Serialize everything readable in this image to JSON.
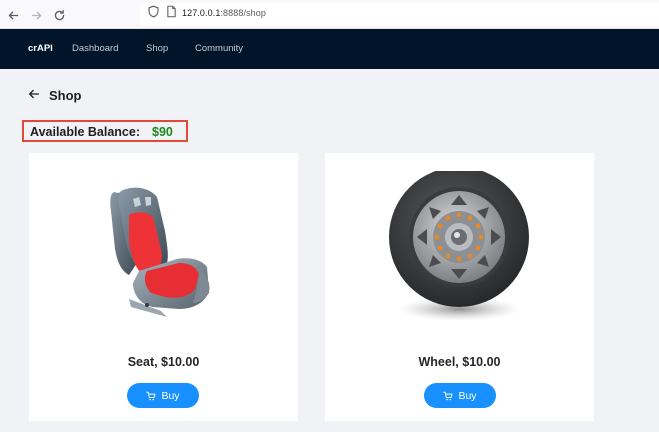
{
  "browser": {
    "url_host": "127.0.0.1",
    "url_path": ":8888/shop",
    "icons": [
      "back-arrow-icon",
      "forward-arrow-icon",
      "reload-icon",
      "shield-icon",
      "page-icon"
    ]
  },
  "navbar": {
    "brand": "crAPI",
    "links": [
      {
        "label": "Dashboard"
      },
      {
        "label": "Shop"
      },
      {
        "label": "Community"
      }
    ]
  },
  "page": {
    "title": "Shop",
    "back_icon": "arrow-left-icon"
  },
  "balance": {
    "label": "Available Balance:",
    "value": "$90",
    "value_color": "#1c8a1c",
    "highlight_color": "#e04a3a"
  },
  "products": [
    {
      "title": "Seat, $10.00",
      "button_label": "Buy",
      "image": "car-seat-image",
      "button_icon": "cart-icon"
    },
    {
      "title": "Wheel, $10.00",
      "button_label": "Buy",
      "image": "wheel-image",
      "button_icon": "cart-icon"
    }
  ],
  "colors": {
    "navbar_bg": "#001529",
    "page_bg": "#f0f2f5",
    "button_bg": "#1890ff"
  }
}
